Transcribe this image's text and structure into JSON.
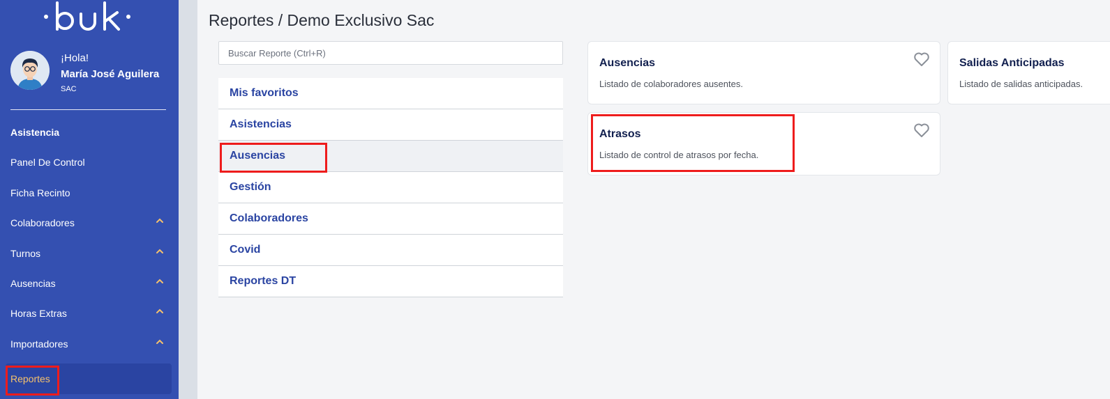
{
  "brand": {
    "logo_text": "·buk·"
  },
  "user": {
    "greeting": "¡Hola!",
    "name": "María José Aguilera",
    "role": "SAC"
  },
  "sidebar": {
    "section": "Asistencia",
    "items": [
      {
        "label": "Panel De Control",
        "expandable": false
      },
      {
        "label": "Ficha Recinto",
        "expandable": false
      },
      {
        "label": "Colaboradores",
        "expandable": true
      },
      {
        "label": "Turnos",
        "expandable": true
      },
      {
        "label": "Ausencias",
        "expandable": true
      },
      {
        "label": "Horas Extras",
        "expandable": true
      },
      {
        "label": "Importadores",
        "expandable": true
      },
      {
        "label": "Reportes",
        "expandable": false,
        "active": true
      }
    ]
  },
  "header": {
    "title": "Reportes / Demo Exclusivo Sac"
  },
  "search": {
    "placeholder": "Buscar Reporte (Ctrl+R)"
  },
  "categories": [
    {
      "label": "Mis favoritos"
    },
    {
      "label": "Asistencias"
    },
    {
      "label": "Ausencias",
      "selected": true
    },
    {
      "label": "Gestión"
    },
    {
      "label": "Colaboradores"
    },
    {
      "label": "Covid"
    },
    {
      "label": "Reportes DT"
    }
  ],
  "reports": [
    {
      "title": "Ausencias",
      "description": "Listado de colaboradores ausentes."
    },
    {
      "title": "Salidas Anticipadas",
      "description": "Listado de salidas anticipadas."
    },
    {
      "title": "Atrasos",
      "description": "Listado de control de atrasos por fecha."
    }
  ],
  "colors": {
    "sidebar": "#3450b1",
    "active_text": "#f5c16c",
    "link": "#2a44a2",
    "highlight": "#ee1c1c"
  }
}
